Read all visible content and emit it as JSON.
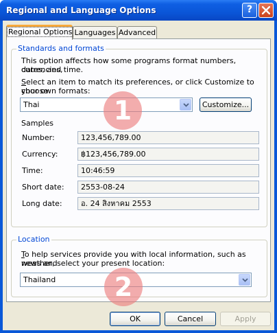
{
  "window": {
    "title": "Regional and Language Options",
    "help_button": "?",
    "close_button": "✕"
  },
  "tabs": [
    {
      "label": "Regional Options",
      "active": true
    },
    {
      "label": "Languages",
      "active": false
    },
    {
      "label": "Advanced",
      "active": false
    }
  ],
  "standards": {
    "group_label": "Standards and formats",
    "description_line1": "This option affects how some programs format numbers, currencies,",
    "description_line2": "dates, and time.",
    "select_line1_underlined": "S",
    "select_line1_rest": "elect an item to match its preferences, or click Customize to choose",
    "select_line2": "your own formats:",
    "format_value": "Thai",
    "customize_button": "Customize...",
    "samples_label": "Samples",
    "samples": [
      {
        "label": "Number:",
        "value": "123,456,789.00"
      },
      {
        "label": "Currency:",
        "value": "฿123,456,789.00"
      },
      {
        "label": "Time:",
        "value": "10:46:59"
      },
      {
        "label": "Short date:",
        "value": "2553-08-24"
      },
      {
        "label": "Long date:",
        "value": "อ. 24 สิงหาคม 2553"
      }
    ]
  },
  "location": {
    "group_label": "Location",
    "help_line1_underlined": "T",
    "help_line1_rest": "o help services provide you with local information, such as news and",
    "help_line2": "weather, select your present location:",
    "location_value": "Thailand"
  },
  "markers": [
    "1",
    "2"
  ],
  "buttons": {
    "ok": "OK",
    "cancel": "Cancel",
    "apply": "Apply"
  },
  "colors": {
    "title_bar": "#0a56d8",
    "group_label": "#0046d5",
    "active_tab_accent": "#f7a83a",
    "marker": "#ec7a7a"
  }
}
